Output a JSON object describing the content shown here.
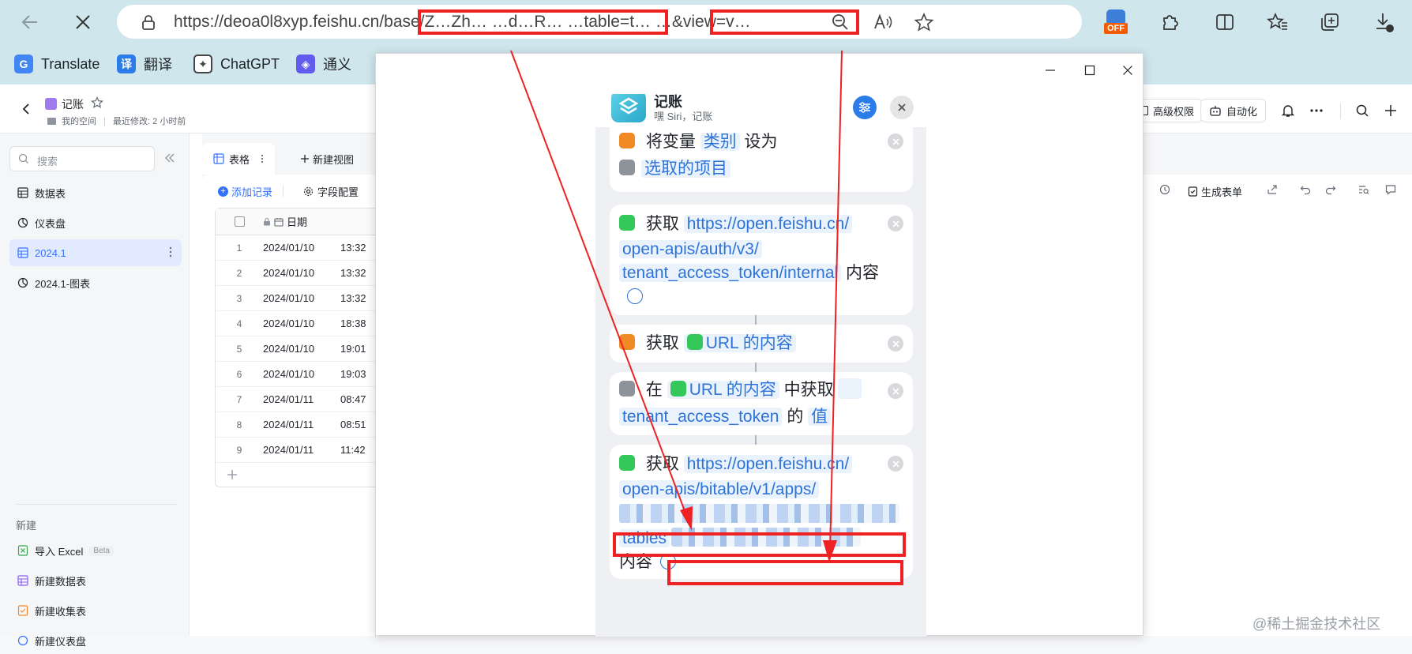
{
  "browser": {
    "url": "https://deoa0l8xyp.feishu.cn/base/Z…Zh… …d…R… …table=t… …&view=v…",
    "ext_badge": "OFF",
    "bookmarks": [
      {
        "label": "Translate",
        "icon": "google-translate-icon",
        "color": "#4285f4"
      },
      {
        "label": "翻译",
        "icon": "translate-icon",
        "color": "#2b7ce8"
      },
      {
        "label": "ChatGPT",
        "icon": "chatgpt-icon",
        "color": "#10a37f"
      },
      {
        "label": "通义",
        "icon": "tongyi-icon",
        "color": "#615ced"
      }
    ]
  },
  "doc": {
    "title": "记账",
    "location": "我的空间",
    "modified": "最近修改: 2 小时前"
  },
  "header_actions": {
    "permissions": "高级权限",
    "automation": "自动化"
  },
  "sidebar": {
    "search_placeholder": "搜索",
    "items": [
      {
        "label": "数据表",
        "icon": "table-icon"
      },
      {
        "label": "仪表盘",
        "icon": "dashboard-icon"
      },
      {
        "label": "2024.1",
        "icon": "table-icon",
        "active": true
      },
      {
        "label": "2024.1-图表",
        "icon": "dashboard-icon"
      }
    ],
    "new_section": "新建",
    "new_items": [
      {
        "label": "导入 Excel",
        "badge": "Beta",
        "icon": "excel-icon"
      },
      {
        "label": "新建数据表",
        "icon": "table-icon"
      },
      {
        "label": "新建收集表",
        "icon": "form-icon"
      },
      {
        "label": "新建仪表盘",
        "icon": "dashboard-icon"
      }
    ]
  },
  "view": {
    "tabs": [
      {
        "label": "表格",
        "icon": "grid-icon",
        "active": true
      },
      {
        "label": "新建视图",
        "icon": "plus-icon"
      }
    ],
    "toolbar": {
      "add_record": "添加记录",
      "field_config": "字段配置",
      "generate_form": "生成表单"
    },
    "date_column": "日期",
    "rows": [
      {
        "n": "1",
        "date": "2024/01/10",
        "time": "13:32"
      },
      {
        "n": "2",
        "date": "2024/01/10",
        "time": "13:32"
      },
      {
        "n": "3",
        "date": "2024/01/10",
        "time": "13:32"
      },
      {
        "n": "4",
        "date": "2024/01/10",
        "time": "18:38"
      },
      {
        "n": "5",
        "date": "2024/01/10",
        "time": "19:01"
      },
      {
        "n": "6",
        "date": "2024/01/10",
        "time": "19:03"
      },
      {
        "n": "7",
        "date": "2024/01/11",
        "time": "08:47"
      },
      {
        "n": "8",
        "date": "2024/01/11",
        "time": "08:51"
      },
      {
        "n": "9",
        "date": "2024/01/11",
        "time": "11:42"
      }
    ]
  },
  "shortcut": {
    "app_name": "记账",
    "app_subtitle": "嘿 Siri，记账",
    "step1": {
      "prefix": "将变量",
      "var": "类别",
      "mid": "设为",
      "value": "选取的项目"
    },
    "step2": {
      "verb": "获取",
      "url1": "https://open.feishu.cn/",
      "url2": "open-apis/auth/v3/",
      "url3": "tenant_access_token/internal",
      "suffix": "内容"
    },
    "step3": {
      "verb": "获取",
      "value": "URL 的内容"
    },
    "step4": {
      "prefix": "在",
      "source": "URL 的内容",
      "mid": "中获取",
      "key": "tenant_access_token",
      "of": "的",
      "value": "值"
    },
    "step5": {
      "verb": "获取",
      "url1": "https://open.feishu.cn/",
      "url2": "open-apis/bitable/v1/apps/",
      "url4": "tables",
      "suffix": "内容"
    }
  },
  "watermark": "@稀土掘金技术社区",
  "colors": {
    "accent": "#3370ff",
    "annotation": "#ee2222",
    "shortcut_blue": "#2e73d8"
  }
}
